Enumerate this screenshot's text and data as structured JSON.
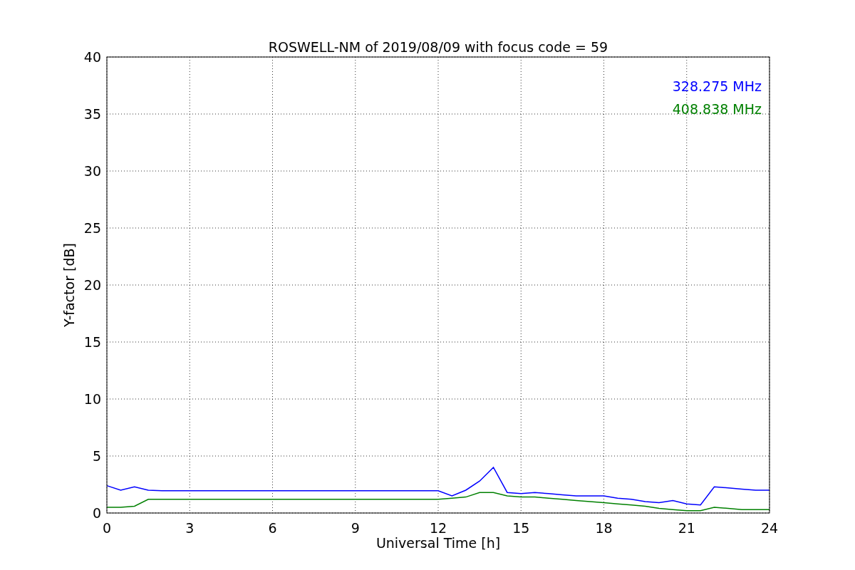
{
  "chart_data": {
    "type": "line",
    "title": "ROSWELL-NM of 2019/08/09 with focus code = 59",
    "xlabel": "Universal Time [h]",
    "ylabel": "Y-factor [dB]",
    "x": [
      0,
      0.5,
      1,
      1.5,
      2,
      3,
      4,
      5,
      6,
      7,
      8,
      9,
      10,
      11,
      12,
      12.5,
      13,
      13.5,
      14,
      14.5,
      15,
      15.5,
      16,
      16.5,
      17,
      17.5,
      18,
      18.5,
      19,
      19.5,
      20,
      20.5,
      21,
      21.5,
      22,
      22.5,
      23,
      23.5,
      24
    ],
    "series": [
      {
        "name": "328.275 MHz",
        "color": "#0000ff",
        "values": [
          2.4,
          2.0,
          2.3,
          2.0,
          1.95,
          1.95,
          1.95,
          1.95,
          1.95,
          1.95,
          1.95,
          1.95,
          1.95,
          1.95,
          1.95,
          1.5,
          2.0,
          2.8,
          4.0,
          1.8,
          1.7,
          1.8,
          1.7,
          1.6,
          1.5,
          1.5,
          1.5,
          1.3,
          1.2,
          1.0,
          0.9,
          1.1,
          0.8,
          0.7,
          2.3,
          2.2,
          2.1,
          2.0,
          2.0
        ]
      },
      {
        "name": "408.838 MHz",
        "color": "#008000",
        "values": [
          0.5,
          0.5,
          0.6,
          1.2,
          1.2,
          1.2,
          1.2,
          1.2,
          1.2,
          1.2,
          1.2,
          1.2,
          1.2,
          1.2,
          1.2,
          1.3,
          1.4,
          1.8,
          1.8,
          1.5,
          1.4,
          1.4,
          1.3,
          1.2,
          1.1,
          1.0,
          0.9,
          0.8,
          0.7,
          0.6,
          0.4,
          0.3,
          0.2,
          0.2,
          0.5,
          0.4,
          0.3,
          0.3,
          0.3
        ]
      }
    ],
    "xlim": [
      0,
      24
    ],
    "ylim": [
      0,
      40
    ],
    "xticks": [
      0,
      3,
      6,
      9,
      12,
      15,
      18,
      21,
      24
    ],
    "yticks": [
      0,
      5,
      10,
      15,
      20,
      25,
      30,
      35,
      40
    ],
    "grid": true
  }
}
